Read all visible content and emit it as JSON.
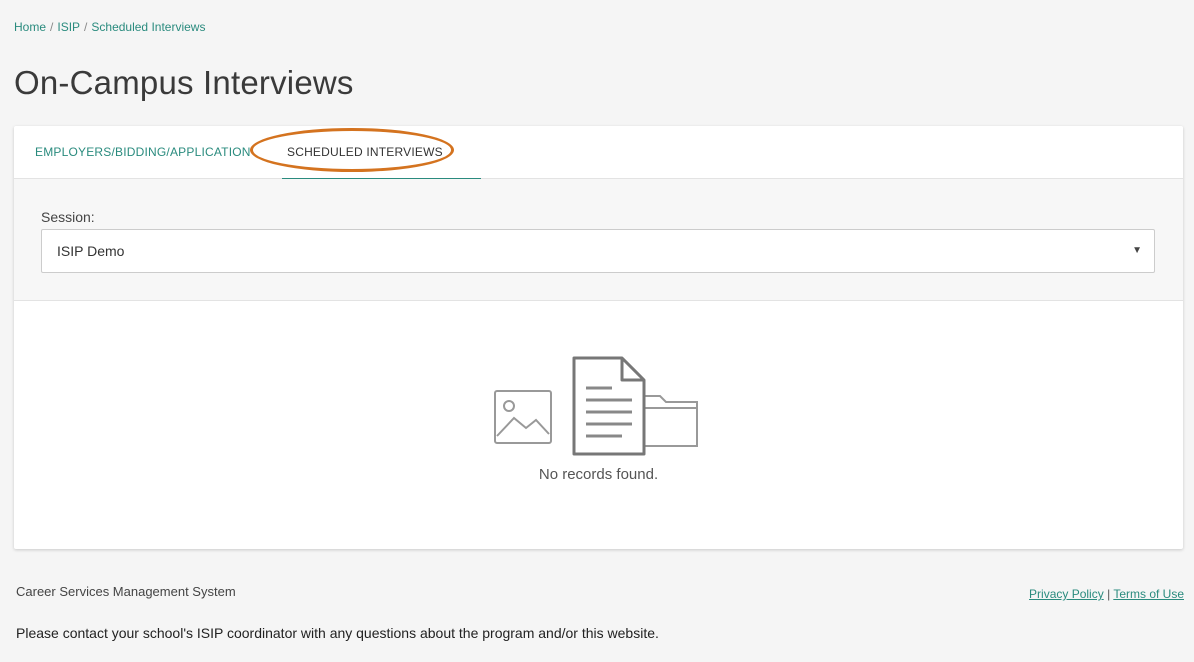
{
  "breadcrumb": {
    "items": [
      "Home",
      "ISIP",
      "Scheduled Interviews"
    ],
    "separator": "/"
  },
  "page": {
    "title": "On-Campus Interviews"
  },
  "tabs": [
    {
      "label": "EMPLOYERS/BIDDING/APPLICATION",
      "active": false
    },
    {
      "label": "SCHEDULED INTERVIEWS",
      "active": true
    }
  ],
  "filter": {
    "session_label": "Session:",
    "session_value": "ISIP Demo"
  },
  "empty_state": {
    "message": "No records found.",
    "icons": [
      "image-icon",
      "document-icon",
      "folder-icon"
    ]
  },
  "footer": {
    "system_name": "Career Services Management System",
    "privacy_link": "Privacy Policy",
    "link_separator": "|",
    "terms_link": "Terms of Use",
    "note": "Please contact your school's ISIP coordinator with any questions about the program and/or this website."
  },
  "colors": {
    "accent": "#2a8b7e",
    "highlight": "#d4731f",
    "background": "#f5f5f5"
  }
}
